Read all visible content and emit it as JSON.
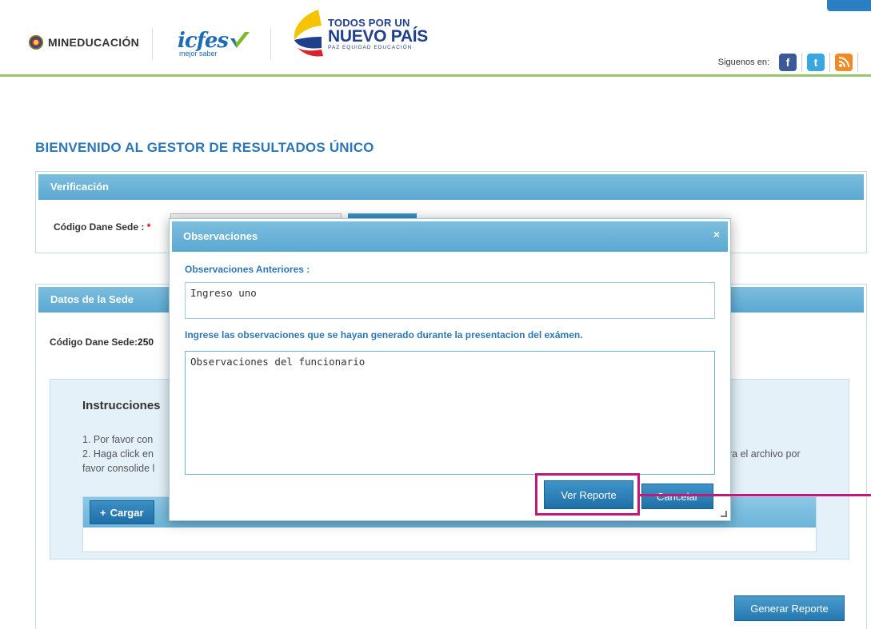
{
  "header": {
    "ministry_logo_text": "MINEDUCACIÓN",
    "icfes_logo_text": "icfes",
    "icfes_tagline": "mejor saber",
    "todos_line1": "TODOS POR UN",
    "todos_line2": "NUEVO PAÍS",
    "todos_line3": "PAZ EQUIDAD EDUCACIÓN",
    "social_label": "Siguenos en:",
    "social_icons": [
      "facebook-icon",
      "twitter-icon",
      "rss-icon"
    ],
    "accent_green": "#9ac56f"
  },
  "page": {
    "title": "BIENVENIDO AL GESTOR DE RESULTADOS ÚNICO",
    "title_color": "#2d77b7"
  },
  "verificacion": {
    "header": "Verificación",
    "codigo_label": "Código Dane Sede :",
    "required_mark": "*"
  },
  "datos_sede": {
    "header": "Datos de la Sede",
    "codigo_label": "Código Dane Sede:",
    "codigo_value": "250"
  },
  "instrucciones": {
    "title": "Instrucciones",
    "line1_start": "1. Por favor con",
    "line2_start": "2. Haga click en",
    "line2_end": "ra el archivo por",
    "line3_start": "favor consolide l",
    "cargar_label": "Cargar"
  },
  "generar_label": "Generar Reporte",
  "modal": {
    "title": "Observaciones",
    "close_label": "×",
    "prev_label": "Observaciones Anteriores :",
    "prev_value": "Ingreso uno",
    "new_label": "Ingrese las observaciones que se hayan generado durante la presentacion del exámen.",
    "new_value": "Observaciones del funcionario",
    "ver_reporte_label": "Ver Reporte",
    "cancelar_label": "Cancelar"
  },
  "colors": {
    "panel_header": "#5aa8d1",
    "button_blue": "#1f6fa7",
    "highlight": "#c2187a"
  }
}
